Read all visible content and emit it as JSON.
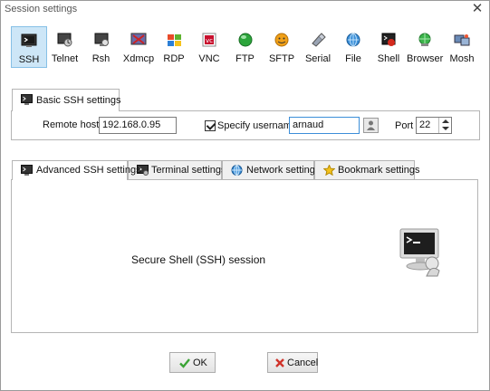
{
  "window": {
    "title": "Session settings"
  },
  "protocols": [
    {
      "label": "SSH",
      "icon": "ssh-icon",
      "active": true
    },
    {
      "label": "Telnet",
      "icon": "telnet-icon"
    },
    {
      "label": "Rsh",
      "icon": "rsh-icon"
    },
    {
      "label": "Xdmcp",
      "icon": "xdmcp-icon"
    },
    {
      "label": "RDP",
      "icon": "rdp-icon"
    },
    {
      "label": "VNC",
      "icon": "vnc-icon"
    },
    {
      "label": "FTP",
      "icon": "ftp-icon"
    },
    {
      "label": "SFTP",
      "icon": "sftp-icon"
    },
    {
      "label": "Serial",
      "icon": "serial-icon"
    },
    {
      "label": "File",
      "icon": "file-icon"
    },
    {
      "label": "Shell",
      "icon": "shell-icon"
    },
    {
      "label": "Browser",
      "icon": "browser-icon"
    },
    {
      "label": "Mosh",
      "icon": "mosh-icon"
    }
  ],
  "basic": {
    "tab_label": "Basic SSH settings",
    "remote_host_label": "Remote host *",
    "remote_host_value": "192.168.0.95",
    "specify_username_label": "Specify username",
    "specify_username_checked": true,
    "username_value": "arnaud",
    "port_label": "Port",
    "port_value": "22"
  },
  "advanced_tabs": [
    {
      "label": "Advanced SSH settings",
      "icon": "terminal-icon"
    },
    {
      "label": "Terminal settings",
      "icon": "terminal-settings-icon"
    },
    {
      "label": "Network settings",
      "icon": "globe-icon"
    },
    {
      "label": "Bookmark settings",
      "icon": "star-icon"
    }
  ],
  "session": {
    "description": "Secure Shell (SSH) session"
  },
  "buttons": {
    "ok": "OK",
    "cancel": "Cancel"
  },
  "colors": {
    "active_protocol_bg": "#cde6f7",
    "active_protocol_border": "#86c0e6",
    "ok_check": "#3aa335",
    "cancel_x": "#d0332a"
  }
}
